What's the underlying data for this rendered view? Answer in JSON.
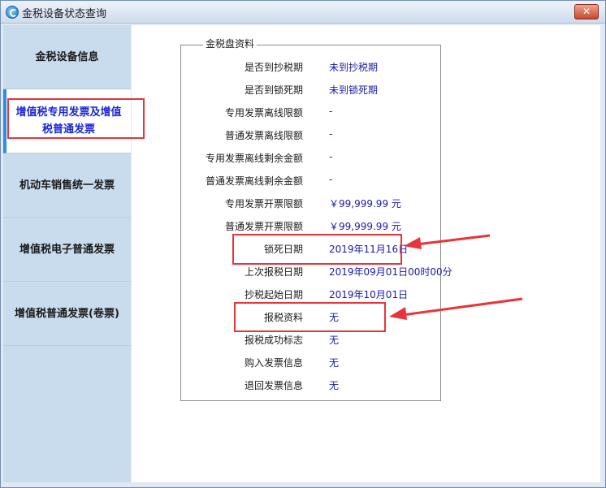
{
  "window": {
    "title": "金税设备状态查询",
    "close_label": "✕"
  },
  "sidebar": {
    "items": [
      {
        "label": "金税设备信息",
        "active": false
      },
      {
        "label": "增值税专用发票及增值税普通发票",
        "active": true
      },
      {
        "label": "机动车销售统一发票",
        "active": false
      },
      {
        "label": "增值税电子普通发票",
        "active": false
      },
      {
        "label": "增值税普通发票(卷票)",
        "active": false
      }
    ]
  },
  "panel": {
    "group_title": "金税盘资料",
    "rows": [
      {
        "label": "是否到抄税期",
        "value": "未到抄税期"
      },
      {
        "label": "是否到锁死期",
        "value": "未到锁死期"
      },
      {
        "label": "专用发票离线限额",
        "value": "-"
      },
      {
        "label": "普通发票离线限额",
        "value": "-"
      },
      {
        "label": "专用发票离线剩余金额",
        "value": "-"
      },
      {
        "label": "普通发票离线剩余金额",
        "value": "-"
      },
      {
        "label": "专用发票开票限额",
        "value": "￥99,999.99 元"
      },
      {
        "label": "普通发票开票限额",
        "value": "￥99,999.99 元"
      },
      {
        "label": "锁死日期",
        "value": "2019年11月16日"
      },
      {
        "label": "上次报税日期",
        "value": "2019年09月01日00时00分"
      },
      {
        "label": "抄税起始日期",
        "value": "2019年10月01日"
      },
      {
        "label": "报税资料",
        "value": "无"
      },
      {
        "label": "报税成功标志",
        "value": "无"
      },
      {
        "label": "购入发票信息",
        "value": "无"
      },
      {
        "label": "退回发票信息",
        "value": "无"
      }
    ]
  },
  "colors": {
    "highlight": "#e8343a",
    "value_text": "#1a1aa8",
    "active_nav_text": "#1a27d6"
  }
}
